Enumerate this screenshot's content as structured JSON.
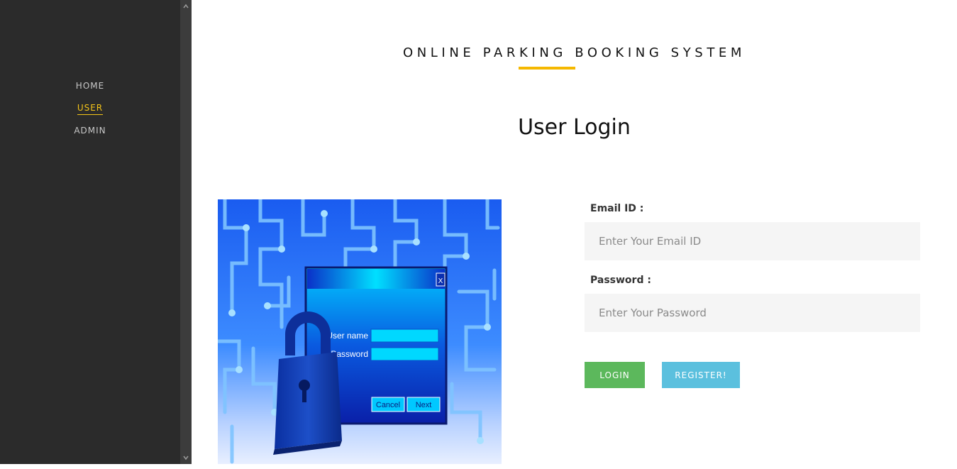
{
  "sidebar": {
    "items": [
      {
        "label": "HOME"
      },
      {
        "label": "USER"
      },
      {
        "label": "ADMIN"
      }
    ]
  },
  "header": {
    "title": "ONLINE PARKING BOOKING SYSTEM"
  },
  "main": {
    "heading": "User Login",
    "illustration": {
      "close_glyph": "X",
      "username_label": "User name",
      "password_label": "Password",
      "cancel_label": "Cancel",
      "next_label": "Next"
    }
  },
  "form": {
    "email_label": "Email ID :",
    "email_placeholder": "Enter Your Email ID",
    "email_value": "",
    "password_label": "Password :",
    "password_placeholder": "Enter Your Password",
    "password_value": "",
    "login_label": "LOGIN",
    "register_label": "REGISTER!"
  },
  "colors": {
    "sidebar_bg": "#2b2b2b",
    "accent": "#f5b800",
    "login_button": "#5cb85c",
    "register_button": "#5bc0de"
  },
  "icons": {
    "scroll_up": "chevron-up-icon",
    "scroll_down": "chevron-down-icon"
  }
}
